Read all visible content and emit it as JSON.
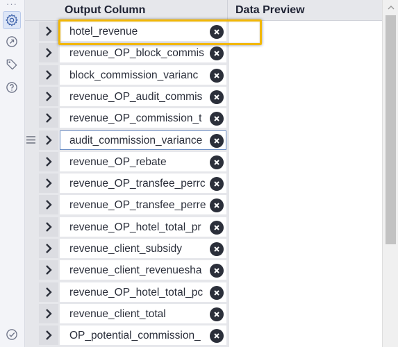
{
  "rail": {
    "icons": [
      "gear-icon",
      "target-arrow-icon",
      "tag-icon",
      "help-icon",
      "check-circle-icon"
    ]
  },
  "grid": {
    "columns": [
      "Output Column",
      "Data Preview"
    ],
    "rows": [
      "hotel_revenue",
      "revenue_OP_block_commis",
      "block_commission_varianc",
      "revenue_OP_audit_commis",
      "revenue_OP_commission_t",
      "audit_commission_variance",
      "revenue_OP_rebate",
      "revenue_OP_transfee_perrc",
      "revenue_OP_transfee_perre",
      "revenue_OP_hotel_total_pr",
      "revenue_client_subsidy",
      "revenue_client_revenuesha",
      "revenue_OP_hotel_total_pc",
      "revenue_client_total",
      "OP_potential_commission_"
    ],
    "focused_row": 5,
    "highlighted_row": 0
  },
  "colors": {
    "highlight": "#f2b705",
    "focus_border": "#6c8ec4"
  }
}
